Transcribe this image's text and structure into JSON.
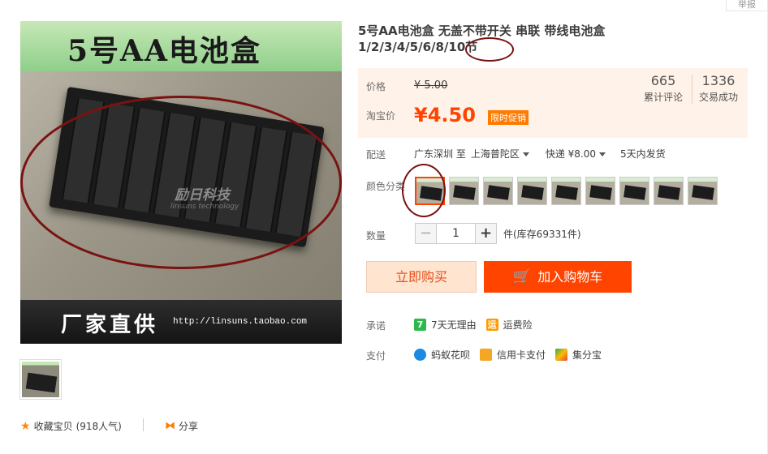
{
  "report": "举报",
  "main_image": {
    "banner_title": "5号AA电池盒",
    "watermark": "励日科技",
    "watermark_sub": "linsuns technology",
    "banner_bottom": "厂家直供",
    "banner_url": "http://linsuns.taobao.com"
  },
  "collect": {
    "label": "收藏宝贝",
    "count": "(918人气)"
  },
  "share": {
    "label": "分享"
  },
  "title": "5号AA电池盒 无盖不带开关 串联 带线电池盒 1/2/3/4/5/6/8/10节",
  "price": {
    "price_label": "价格",
    "original": "¥ 5.00",
    "taobao_label": "淘宝价",
    "current": "¥4.50",
    "promo": "限时促销",
    "reviews_count": "665",
    "reviews_label": "累计评论",
    "deals_count": "1336",
    "deals_label": "交易成功"
  },
  "delivery": {
    "label": "配送",
    "from": "广东深圳 至",
    "to": "上海普陀区",
    "express": "快递 ¥8.00",
    "ship_time": "5天内发货"
  },
  "color": {
    "label": "颜色分类",
    "swatch_count": 9,
    "selected_index": 0
  },
  "quantity": {
    "label": "数量",
    "value": "1",
    "minus": "−",
    "plus": "+",
    "stock": "件(库存69331件)"
  },
  "buttons": {
    "buy_now": "立即购买",
    "add_cart": "加入购物车"
  },
  "promise": {
    "label": "承诺",
    "items": [
      "7天无理由",
      "运费险"
    ],
    "icon_text": [
      "7",
      "运"
    ]
  },
  "payment": {
    "label": "支付",
    "items": [
      "蚂蚁花呗",
      "信用卡支付",
      "集分宝"
    ]
  },
  "colors": {
    "accent": "#ff4400",
    "price": "#f40",
    "annotation": "#7a1212"
  }
}
